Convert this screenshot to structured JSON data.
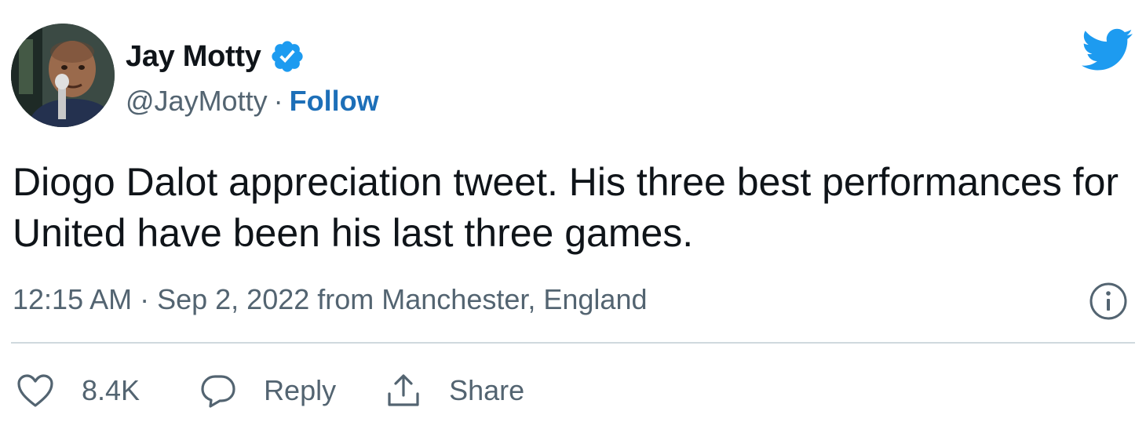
{
  "author": {
    "name": "Jay Motty",
    "handle": "@JayMotty",
    "separator": "·",
    "follow_label": "Follow",
    "verified_icon": "verified-badge-icon",
    "avatar": "avatar"
  },
  "brand": {
    "icon": "twitter-bird-icon",
    "color": "#1d9bf0"
  },
  "tweet": {
    "text": "Diogo Dalot appreciation tweet. His three best performances for United have been his last three games.",
    "timestamp": "12:15 AM · Sep 2, 2022 from Manchester, England",
    "info_icon": "info-icon"
  },
  "actions": {
    "like_icon": "heart-icon",
    "like_count": "8.4K",
    "reply_icon": "reply-bubble-icon",
    "reply_label": "Reply",
    "share_icon": "share-icon",
    "share_label": "Share"
  },
  "colors": {
    "text": "#0f1419",
    "secondary": "#536471",
    "link": "#1d6fb8",
    "divider": "#cfd9de"
  }
}
